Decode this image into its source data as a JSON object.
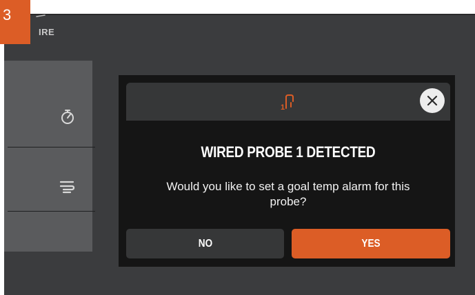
{
  "step": {
    "number": "3"
  },
  "header": {
    "brand_text": "IRE"
  },
  "sidebar": {
    "items": [
      {
        "icon": "timer-icon"
      },
      {
        "icon": "smoke-icon"
      },
      {
        "icon": ""
      }
    ]
  },
  "modal": {
    "header_icon": "probe-1-icon",
    "title": "WIRED PROBE 1 DETECTED",
    "message": "Would you like to set a goal temp alarm for this probe?",
    "no_label": "NO",
    "yes_label": "YES",
    "close_icon": "close-icon"
  },
  "colors": {
    "accent": "#dc5d26",
    "screen_bg": "#3b3c3e",
    "panel_bg": "#5a5b5d",
    "modal_bg": "#151515",
    "modal_header_bg": "#363738"
  }
}
